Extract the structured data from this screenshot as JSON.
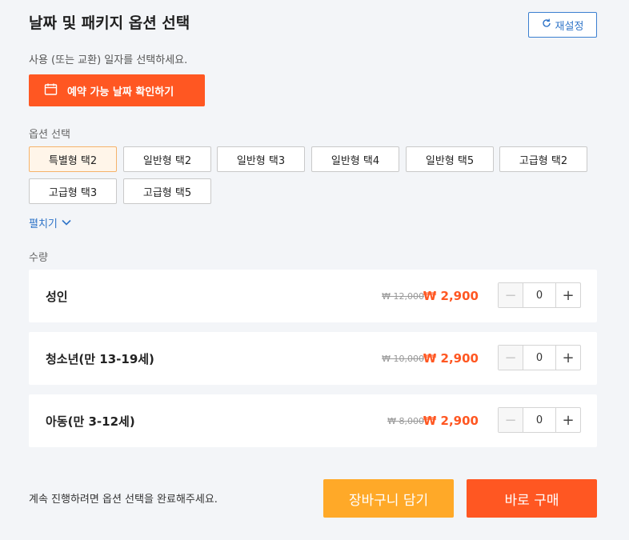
{
  "header": {
    "title": "날짜 및 패키지 옵션 선택",
    "reset_label": "재설정"
  },
  "date": {
    "instruction": "사용 (또는 교환) 일자를 선택하세요.",
    "button_label": "예약 가능 날짜 확인하기"
  },
  "options": {
    "label": "옵션 선택",
    "items": [
      {
        "label": "특별형 택2",
        "selected": true
      },
      {
        "label": "일반형 택2",
        "selected": false
      },
      {
        "label": "일반형 택3",
        "selected": false
      },
      {
        "label": "일반형 택4",
        "selected": false
      },
      {
        "label": "일반형 택5",
        "selected": false
      },
      {
        "label": "고급형 택2",
        "selected": false
      },
      {
        "label": "고급형 택3",
        "selected": false
      },
      {
        "label": "고급형 택5",
        "selected": false
      }
    ],
    "expand_label": "펼치기"
  },
  "quantity": {
    "label": "수량",
    "rows": [
      {
        "name": "성인",
        "old_price": "₩ 12,000",
        "price": "₩ 2,900",
        "count": "0"
      },
      {
        "name": "청소년(만 13-19세)",
        "old_price": "₩ 10,000",
        "price": "₩ 2,900",
        "count": "0"
      },
      {
        "name": "아동(만 3-12세)",
        "old_price": "₩ 8,000",
        "price": "₩ 2,900",
        "count": "0"
      }
    ]
  },
  "footer": {
    "note": "계속 진행하려면 옵션 선택을 완료해주세요.",
    "cart_label": "장바구니 담기",
    "buy_label": "바로 구매"
  },
  "colors": {
    "accent": "#ff5722",
    "cart": "#ffa928",
    "link": "#2f74c8"
  }
}
